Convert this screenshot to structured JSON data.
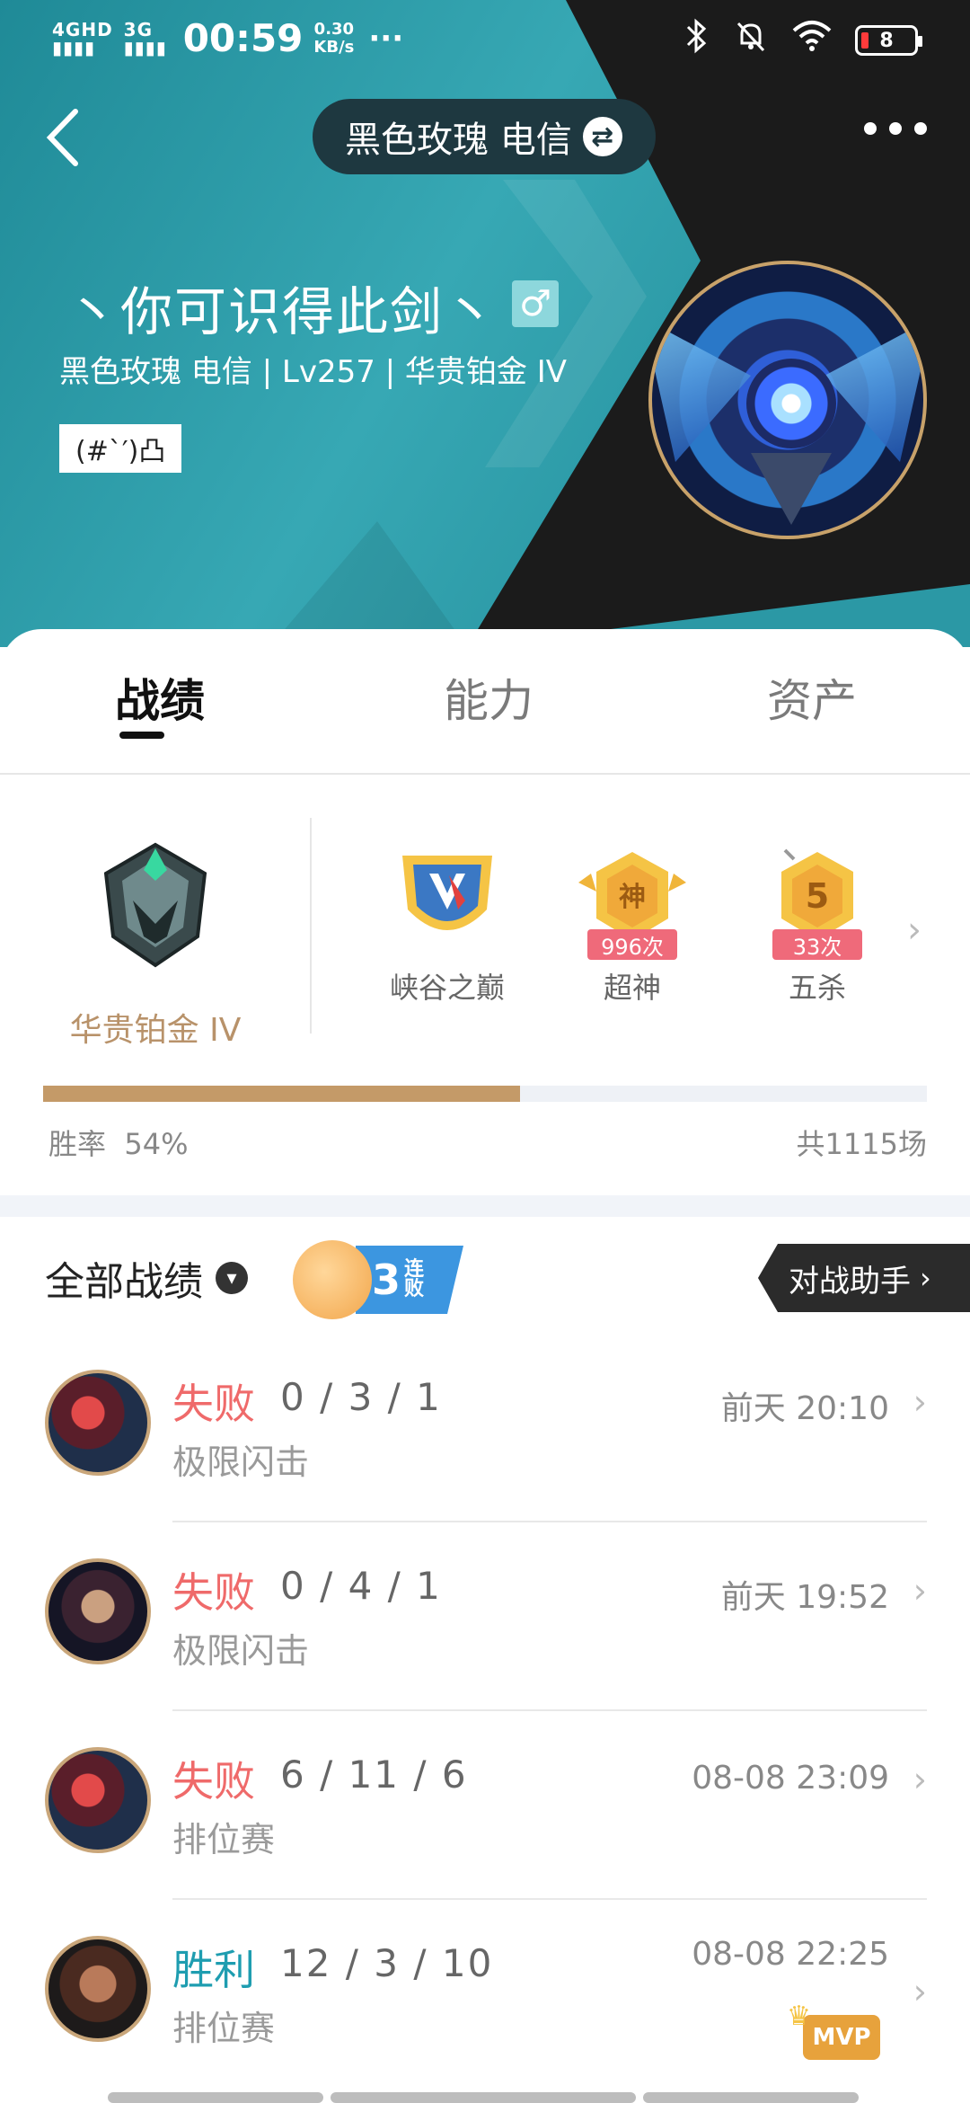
{
  "status_bar": {
    "signal1": "4GHD",
    "signal2": "3G",
    "time": "00:59",
    "speed_value": "0.30",
    "speed_unit": "KB/s",
    "more": "···",
    "battery": "8"
  },
  "header": {
    "account_label": "黑色玫瑰 电信",
    "nickname": "丶你可识得此剑丶",
    "gender_symbol": "♂",
    "subline": "黑色玫瑰 电信 | Lv257 | 华贵铂金 IV",
    "signature": "(#`′)凸"
  },
  "tabs": [
    {
      "label": "战绩"
    },
    {
      "label": "能力"
    },
    {
      "label": "资产"
    }
  ],
  "rank": {
    "name": "华贵铂金 IV",
    "honors": [
      {
        "label": "峡谷之巅",
        "count": ""
      },
      {
        "label": "超神",
        "badge_char": "神",
        "count": "996次"
      },
      {
        "label": "五杀",
        "badge_char": "5",
        "count": "33次"
      }
    ],
    "winrate_label": "胜率",
    "winrate_value": "54%",
    "winrate_fraction": 0.54,
    "total_games": "共1115场"
  },
  "records": {
    "title": "全部战绩",
    "streak_text": "3连败",
    "streak_num": "3",
    "assistant_label": "对战助手",
    "matches": [
      {
        "result": "失败",
        "kda": "0 / 3 / 1",
        "mode": "极限闪击",
        "time": "前天 20:10",
        "mvp": ""
      },
      {
        "result": "失败",
        "kda": "0 / 4 / 1",
        "mode": "极限闪击",
        "time": "前天 19:52",
        "mvp": ""
      },
      {
        "result": "失败",
        "kda": "6 / 11 / 6",
        "mode": "排位赛",
        "time": "08-08 23:09",
        "mvp": ""
      },
      {
        "result": "胜利",
        "kda": "12 / 3 / 10",
        "mode": "排位赛",
        "time": "08-08 22:25",
        "mvp": "MVP"
      }
    ]
  },
  "colors": {
    "teal": "#2a9aa6",
    "dark": "#1b1b1b",
    "gold": "#c49a68",
    "loss": "#ef6a6a",
    "win": "#1e9db0"
  }
}
